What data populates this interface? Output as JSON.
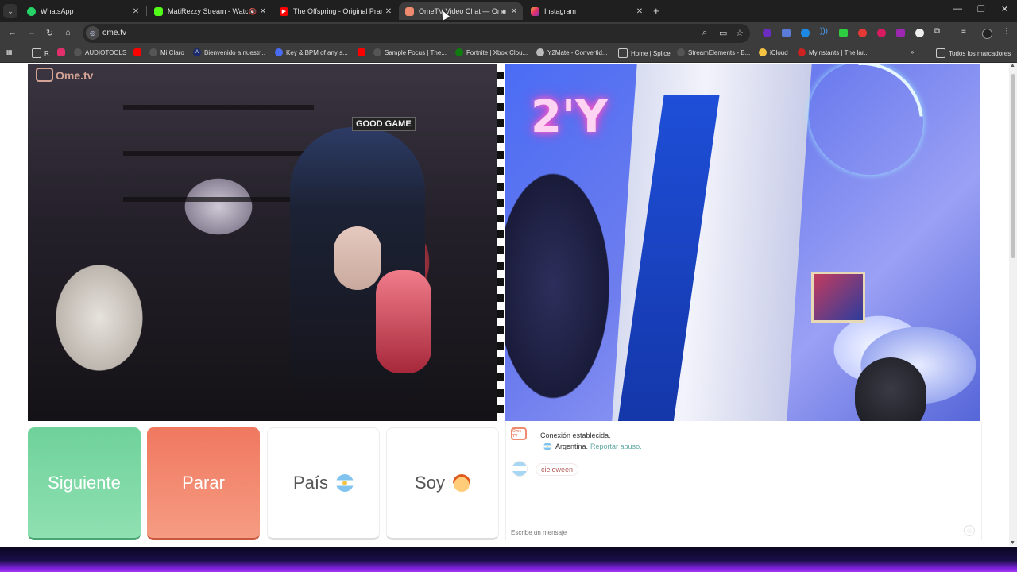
{
  "browser": {
    "tabs": [
      {
        "title": "WhatsApp",
        "icon": "whatsapp-icon",
        "color": "#25d366",
        "active": false
      },
      {
        "title": "MatiRezzy Stream - Watch L",
        "icon": "kick-icon",
        "color": "#53fc18",
        "active": false
      },
      {
        "title": "The Offspring - Original Prank",
        "icon": "youtube-icon",
        "color": "#ff0000",
        "active": false
      },
      {
        "title": "OmeTV Video Chat — Ome",
        "icon": "ometv-icon",
        "color": "#ef8a6e",
        "active": true
      },
      {
        "title": "Instagram",
        "icon": "instagram-icon",
        "color": "#e1306c",
        "active": false
      }
    ],
    "url": "ome.tv",
    "bookmarks": [
      {
        "label": "R",
        "color": "#cccccc"
      },
      {
        "label": "",
        "color": "#e1306c"
      },
      {
        "label": "AUDIOTOOLS",
        "color": "#333333"
      },
      {
        "label": "",
        "color": "#ff0000"
      },
      {
        "label": "Mi Claro",
        "color": "#333333"
      },
      {
        "label": "Bienvenido a nuestr...",
        "color": "#1a2a6c"
      },
      {
        "label": "Key & BPM of any s...",
        "color": "#4a6cf4"
      },
      {
        "label": "",
        "color": "#ff0000"
      },
      {
        "label": "Sample Focus | The...",
        "color": "#333333"
      },
      {
        "label": "Fortnite | Xbox Clou...",
        "color": "#107c10"
      },
      {
        "label": "Y2Mate - Convertid...",
        "color": "#bbbbbb"
      },
      {
        "label": "Home | Splice",
        "color": "#333333"
      },
      {
        "label": "StreamElements - B...",
        "color": "#333333"
      },
      {
        "label": "iCloud",
        "color": "#f6c343"
      },
      {
        "label": "Myinstants | The lar...",
        "color": "#cc2222"
      }
    ],
    "all_bookmarks": "Todos los marcadores"
  },
  "ometv": {
    "logo": "Ome.tv",
    "buttons": {
      "next": "Siguiente",
      "stop": "Parar",
      "country": "País",
      "gender": "Soy"
    },
    "chat": {
      "system_icon": "Ome TV",
      "system_message": "Conexión establecida.",
      "country": "Argentina.",
      "report": "Reportar abuso.",
      "stranger_message": "cieloween",
      "input_placeholder": "Escribe un mensaje"
    }
  },
  "scene": {
    "remote_neon": "2'Y",
    "local_sign": "GOOD GAME"
  },
  "colors": {
    "next": "#6fd29a",
    "stop": "#f07860",
    "accent": "#ef8a6e"
  }
}
